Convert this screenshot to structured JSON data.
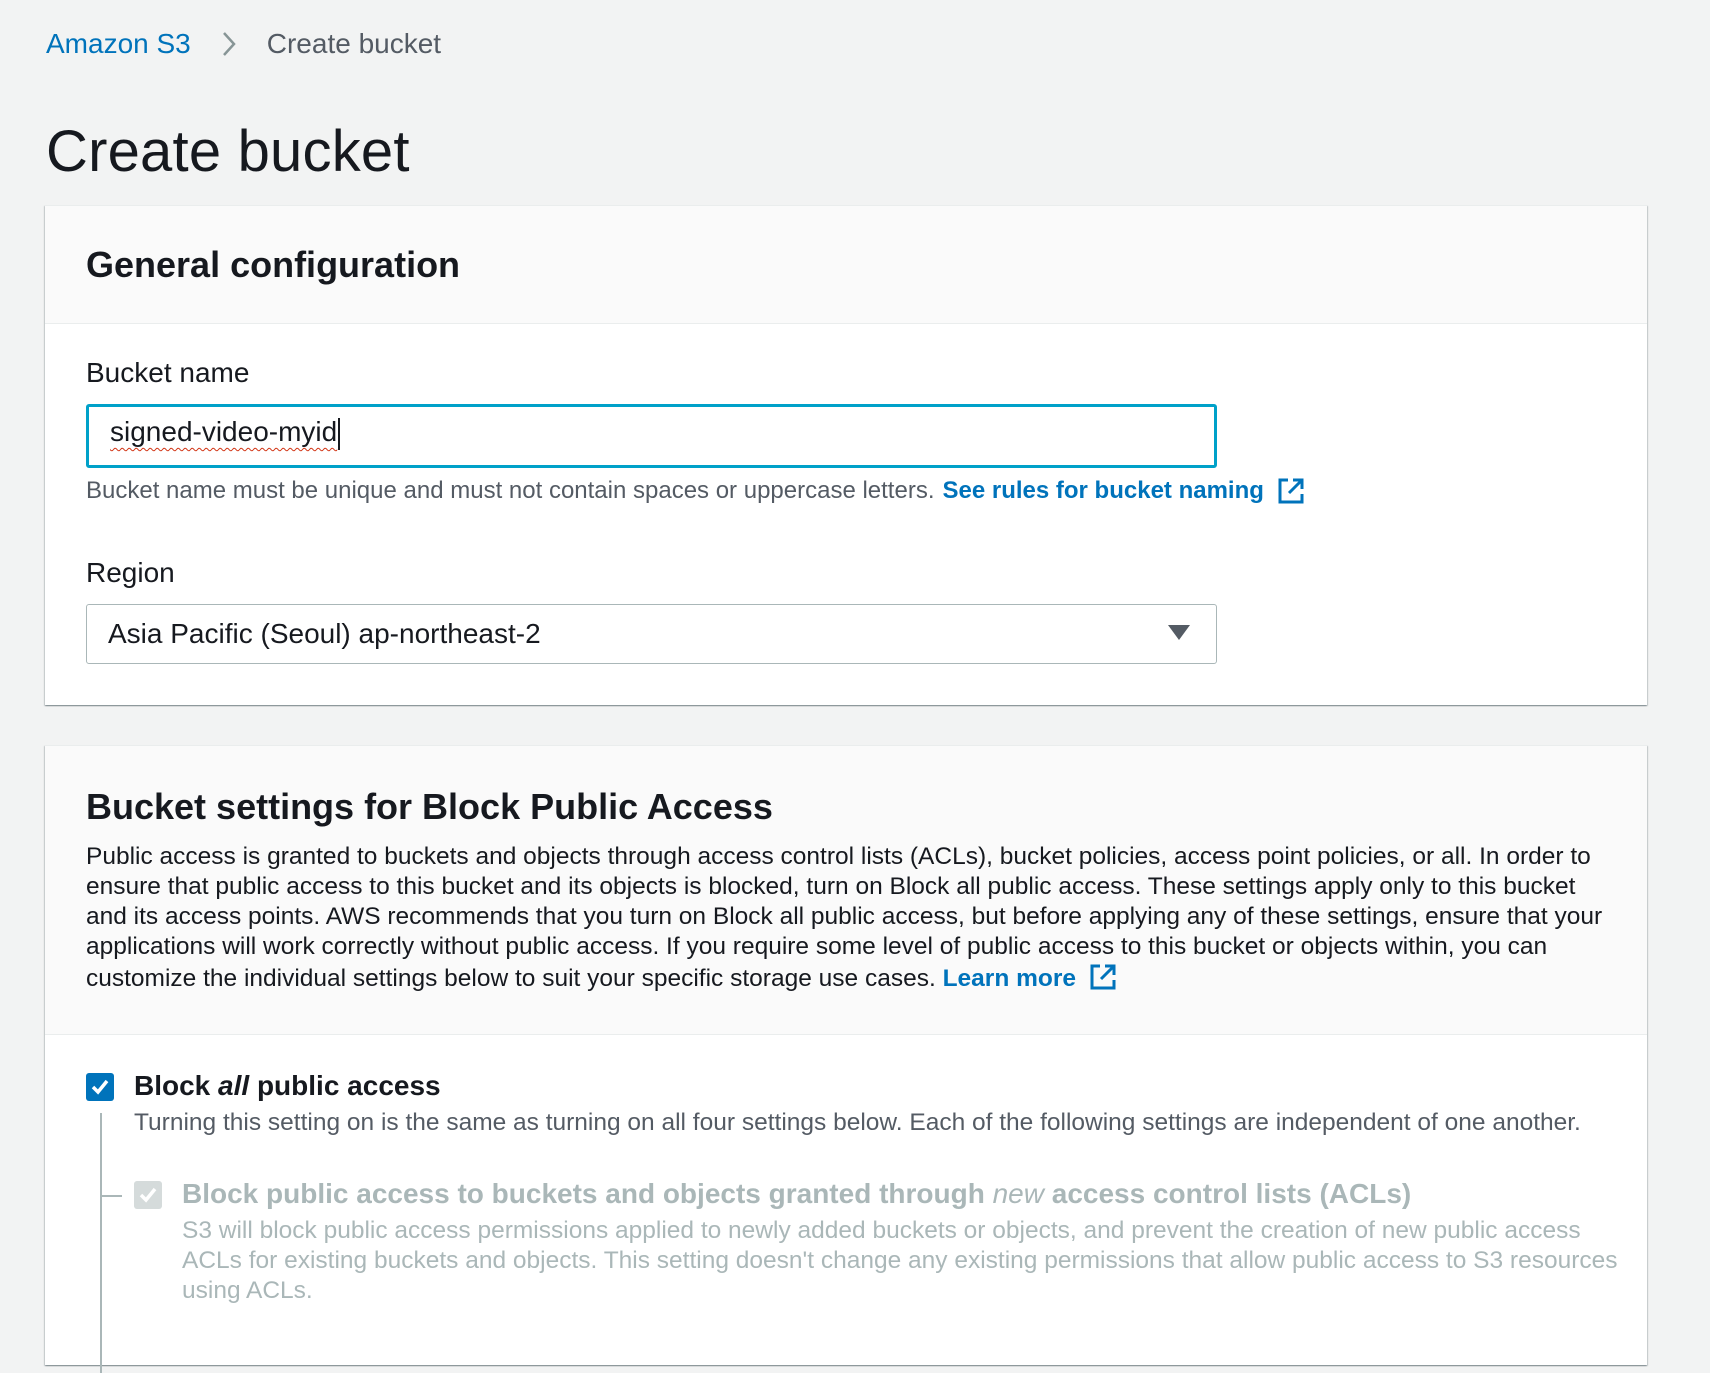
{
  "breadcrumb": {
    "root": "Amazon S3",
    "current": "Create bucket"
  },
  "page_title": "Create bucket",
  "general": {
    "title": "General configuration",
    "bucket_name_label": "Bucket name",
    "bucket_name_value": "signed-video-myid",
    "bucket_name_hint": "Bucket name must be unique and must not contain spaces or uppercase letters.",
    "bucket_name_rules_link": "See rules for bucket naming",
    "region_label": "Region",
    "region_value": "Asia Pacific (Seoul) ap-northeast-2"
  },
  "bpa": {
    "title": "Bucket settings for Block Public Access",
    "description": "Public access is granted to buckets and objects through access control lists (ACLs), bucket policies, access point policies, or all. In order to ensure that public access to this bucket and its objects is blocked, turn on Block all public access. These settings apply only to this bucket and its access points. AWS recommends that you turn on Block all public access, but before applying any of these settings, ensure that your applications will work correctly without public access. If you require some level of public access to this bucket or objects within, you can customize the individual settings below to suit your specific storage use cases.",
    "learn_more": "Learn more",
    "block_all": {
      "title_pre": "Block ",
      "title_em": "all",
      "title_post": " public access",
      "description": "Turning this setting on is the same as turning on all four settings below. Each of the following settings are independent of one another.",
      "checked": true
    },
    "block_new_acls": {
      "title_pre": "Block public access to buckets and objects granted through ",
      "title_em": "new",
      "title_post": " access control lists (ACLs)",
      "description": "S3 will block public access permissions applied to newly added buckets or objects, and prevent the creation of new public access ACLs for existing buckets and objects. This setting doesn't change any existing permissions that allow public access to S3 resources using ACLs.",
      "checked": true,
      "disabled": true
    }
  },
  "colors": {
    "link": "#0073bb",
    "focus_border": "#00a1c9",
    "checkbox_checked": "#0073bb",
    "checkbox_disabled": "#d5dbdb",
    "page_bg": "#f2f3f3"
  }
}
